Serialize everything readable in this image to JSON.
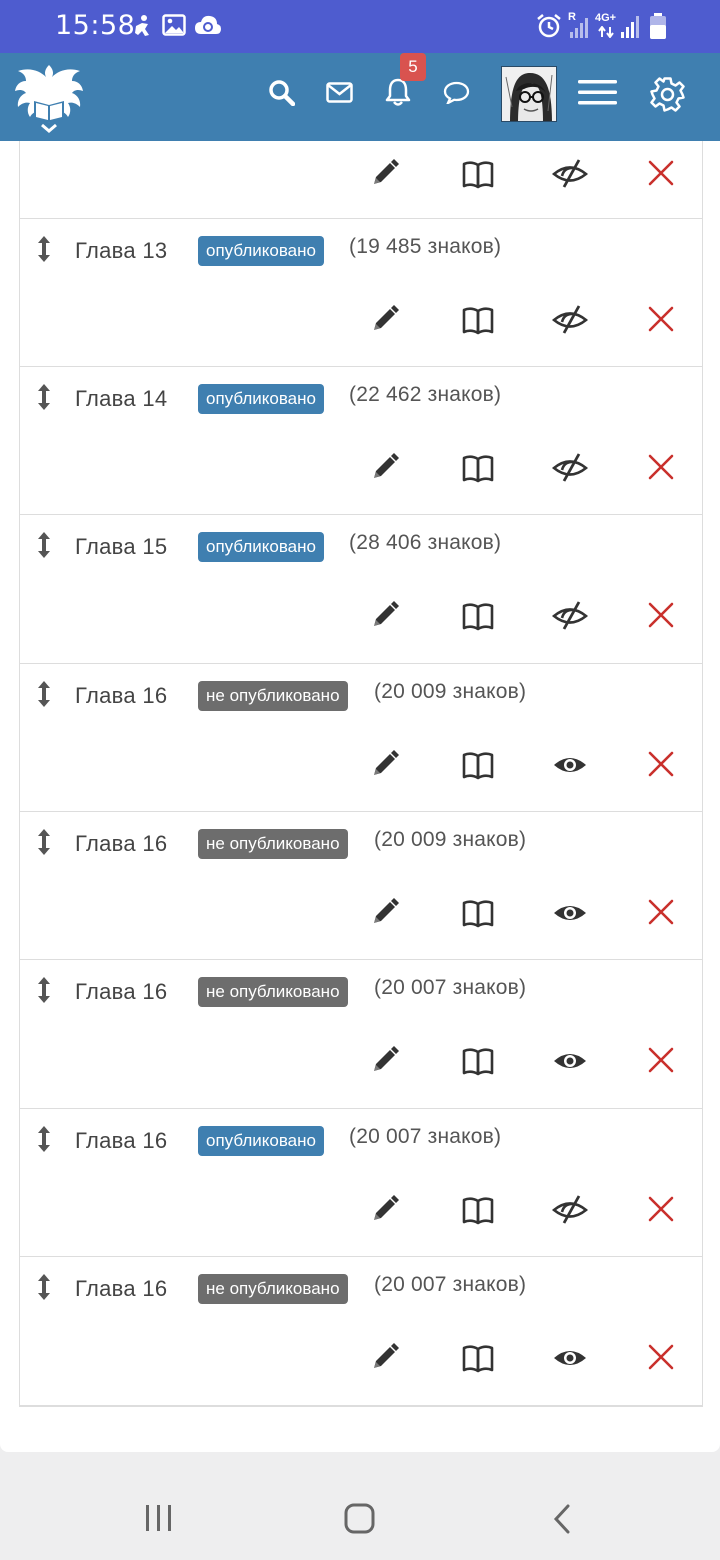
{
  "status_bar": {
    "time": "15:58",
    "network": "4G+",
    "roaming": "R"
  },
  "header": {
    "notification_count": "5",
    "icons": [
      "logo-icon",
      "search-icon",
      "mail-icon",
      "bell-icon",
      "chat-icon",
      "avatar",
      "menu-icon",
      "gear-icon"
    ]
  },
  "chapters": [
    {
      "title": "",
      "status": "",
      "status_type": "none",
      "chars": "",
      "visibility": "hidden"
    },
    {
      "title": "Глава 13",
      "status": "опубликовано",
      "status_type": "pub",
      "chars": "(19 485 знаков)",
      "visibility": "hidden"
    },
    {
      "title": "Глава 14",
      "status": "опубликовано",
      "status_type": "pub",
      "chars": "(22 462 знаков)",
      "visibility": "hidden"
    },
    {
      "title": "Глава 15",
      "status": "опубликовано",
      "status_type": "pub",
      "chars": "(28 406 знаков)",
      "visibility": "hidden"
    },
    {
      "title": "Глава 16",
      "status": "не опубликовано",
      "status_type": "unpub",
      "chars": "(20 009 знаков)",
      "visibility": "visible"
    },
    {
      "title": "Глава 16",
      "status": "не опубликовано",
      "status_type": "unpub",
      "chars": "(20 009 знаков)",
      "visibility": "visible"
    },
    {
      "title": "Глава 16",
      "status": "не опубликовано",
      "status_type": "unpub",
      "chars": "(20 007 знаков)",
      "visibility": "visible"
    },
    {
      "title": "Глава 16",
      "status": "опубликовано",
      "status_type": "pub",
      "chars": "(20 007 знаков)",
      "visibility": "hidden"
    },
    {
      "title": "Глава 16",
      "status": "не опубликовано",
      "status_type": "unpub",
      "chars": "(20 007 знаков)",
      "visibility": "visible"
    }
  ],
  "colors": {
    "status_bar": "#4e5ccf",
    "header": "#3f7fb0",
    "published_badge": "#3f7fb0",
    "unpublished_badge": "#6d6d6d",
    "delete_icon": "#c9302c",
    "notification_badge": "#d9534f"
  },
  "nav_bar": {
    "icons": [
      "recent-apps-icon",
      "home-icon",
      "back-icon"
    ]
  }
}
